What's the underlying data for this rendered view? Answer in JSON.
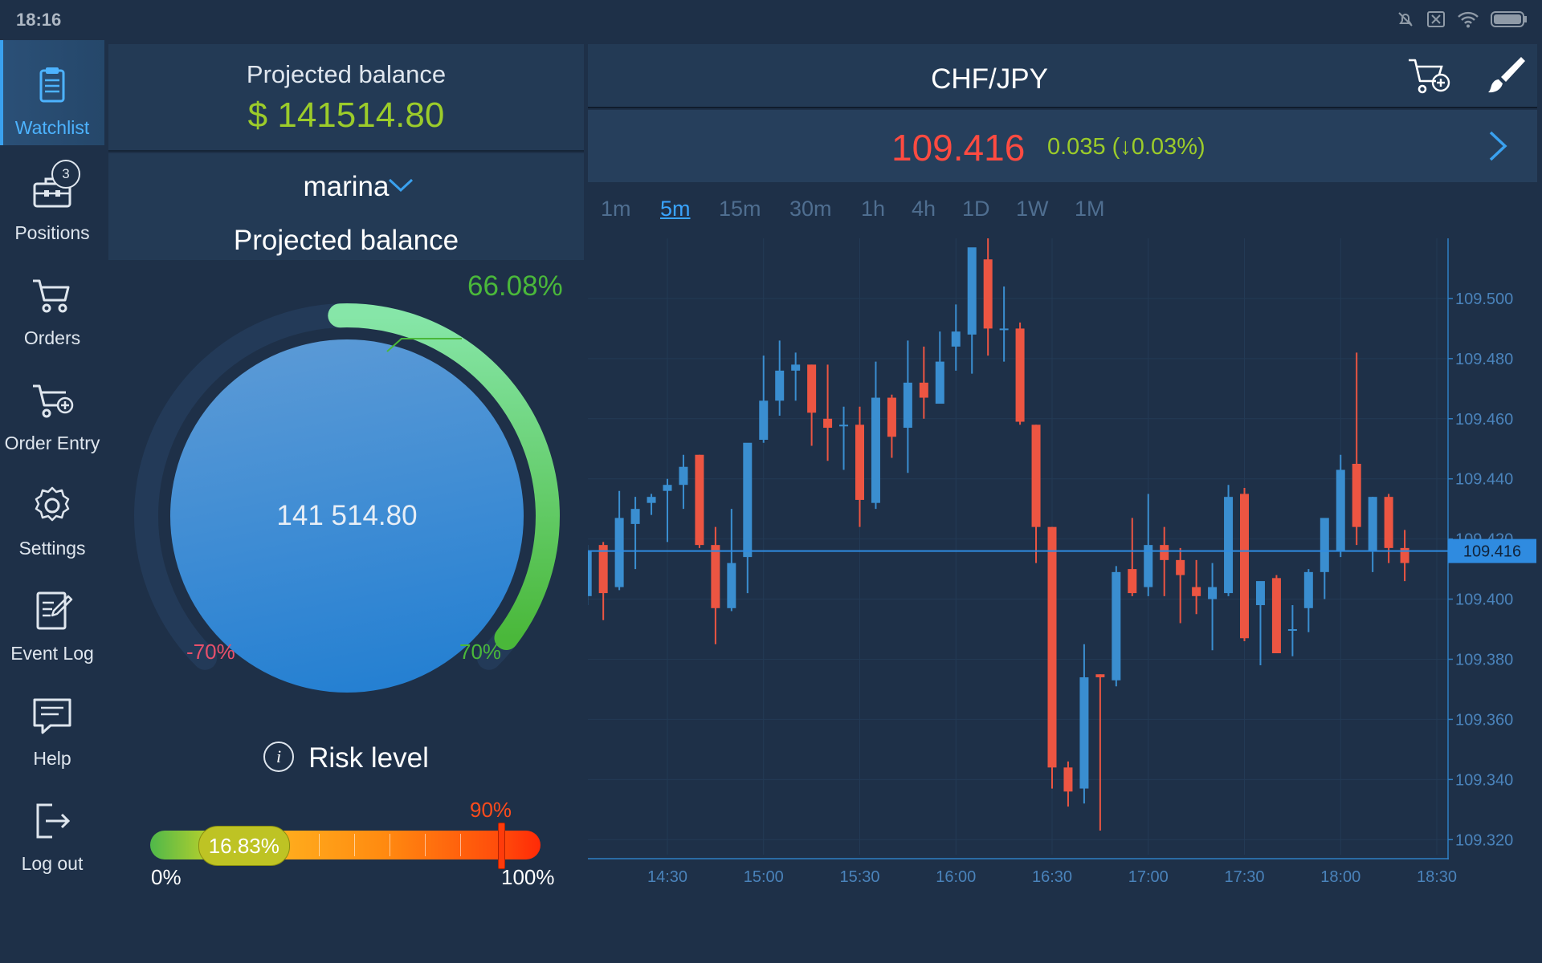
{
  "status_bar": {
    "time": "18:16",
    "icons": [
      "mute-icon",
      "notification-off-icon",
      "wifi-icon",
      "battery-icon"
    ]
  },
  "nav": {
    "items": [
      {
        "label": "Watchlist",
        "icon": "clipboard-icon",
        "active": true
      },
      {
        "label": "Positions",
        "icon": "briefcase-icon",
        "badge": "3"
      },
      {
        "label": "Orders",
        "icon": "cart-icon"
      },
      {
        "label": "Order Entry",
        "icon": "cart-add-icon"
      },
      {
        "label": "Settings",
        "icon": "gear-icon"
      },
      {
        "label": "Event Log",
        "icon": "event-log-icon"
      },
      {
        "label": "Help",
        "icon": "help-chat-icon"
      },
      {
        "label": "Log out",
        "icon": "logout-icon"
      }
    ]
  },
  "account": {
    "header_label": "Projected balance",
    "header_value": "$ 141514.80",
    "account_name": "marina",
    "gauge_title": "Projected balance",
    "gauge_value": "141 514.80",
    "gauge_percent_label": "66.08%",
    "gauge_percent": 66.08,
    "gauge_min_label": "-70%",
    "gauge_max_label": "70%",
    "risk_title": "Risk level",
    "risk_value_label": "16.83%",
    "risk_value": 16.83,
    "risk_threshold_label": "90%",
    "risk_threshold": 90,
    "risk_min_label": "0%",
    "risk_max_label": "100%"
  },
  "chart_panel": {
    "symbol": "CHF/JPY",
    "price": "109.416",
    "change": "0.035 (↓0.03%)",
    "timeframes": [
      "1m",
      "5m",
      "15m",
      "30m",
      "1h",
      "4h",
      "1D",
      "1W",
      "1M"
    ],
    "selected_timeframe": "5m"
  },
  "colors": {
    "up": "#3a8ed0",
    "down": "#ec5542",
    "accent": "#3aa1ef",
    "positive": "#9ccc2a",
    "negative": "#ff4b41"
  },
  "chart_data": {
    "type": "candlestick",
    "title": "",
    "ylim": [
      109.315,
      109.52
    ],
    "y_ticks": [
      109.5,
      109.48,
      109.46,
      109.44,
      109.42,
      109.4,
      109.38,
      109.36,
      109.34,
      109.32
    ],
    "y_tick_labels": [
      "109.500",
      "109.480",
      "109.460",
      "109.440",
      "109.420",
      "109.400",
      "109.380",
      "109.360",
      "109.340",
      "109.320"
    ],
    "x_tick_labels": [
      "14:30",
      "15:00",
      "15:30",
      "16:00",
      "16:30",
      "17:00",
      "17:30",
      "18:00",
      "18:30"
    ],
    "current_price": 109.416,
    "current_price_label": "109.416",
    "candles": [
      {
        "t": "14:05",
        "o": 109.401,
        "h": 109.418,
        "l": 109.398,
        "c": 109.416
      },
      {
        "t": "14:10",
        "o": 109.418,
        "h": 109.419,
        "l": 109.393,
        "c": 109.402
      },
      {
        "t": "14:15",
        "o": 109.404,
        "h": 109.436,
        "l": 109.403,
        "c": 109.427
      },
      {
        "t": "14:20",
        "o": 109.425,
        "h": 109.434,
        "l": 109.41,
        "c": 109.43
      },
      {
        "t": "14:25",
        "o": 109.432,
        "h": 109.435,
        "l": 109.428,
        "c": 109.434
      },
      {
        "t": "14:30",
        "o": 109.436,
        "h": 109.44,
        "l": 109.419,
        "c": 109.438
      },
      {
        "t": "14:35",
        "o": 109.438,
        "h": 109.448,
        "l": 109.43,
        "c": 109.444
      },
      {
        "t": "14:40",
        "o": 109.448,
        "h": 109.448,
        "l": 109.417,
        "c": 109.418
      },
      {
        "t": "14:45",
        "o": 109.418,
        "h": 109.424,
        "l": 109.385,
        "c": 109.397
      },
      {
        "t": "14:50",
        "o": 109.397,
        "h": 109.43,
        "l": 109.396,
        "c": 109.412
      },
      {
        "t": "14:55",
        "o": 109.414,
        "h": 109.45,
        "l": 109.402,
        "c": 109.452
      },
      {
        "t": "15:00",
        "o": 109.453,
        "h": 109.481,
        "l": 109.452,
        "c": 109.466
      },
      {
        "t": "15:05",
        "o": 109.466,
        "h": 109.486,
        "l": 109.461,
        "c": 109.476
      },
      {
        "t": "15:10",
        "o": 109.476,
        "h": 109.482,
        "l": 109.466,
        "c": 109.478
      },
      {
        "t": "15:15",
        "o": 109.478,
        "h": 109.478,
        "l": 109.451,
        "c": 109.462
      },
      {
        "t": "15:20",
        "o": 109.46,
        "h": 109.478,
        "l": 109.446,
        "c": 109.457
      },
      {
        "t": "15:25",
        "o": 109.458,
        "h": 109.464,
        "l": 109.443,
        "c": 109.458
      },
      {
        "t": "15:30",
        "o": 109.458,
        "h": 109.464,
        "l": 109.424,
        "c": 109.433
      },
      {
        "t": "15:35",
        "o": 109.432,
        "h": 109.479,
        "l": 109.43,
        "c": 109.467
      },
      {
        "t": "15:40",
        "o": 109.467,
        "h": 109.468,
        "l": 109.447,
        "c": 109.454
      },
      {
        "t": "15:45",
        "o": 109.457,
        "h": 109.486,
        "l": 109.442,
        "c": 109.472
      },
      {
        "t": "15:50",
        "o": 109.472,
        "h": 109.484,
        "l": 109.46,
        "c": 109.467
      },
      {
        "t": "15:55",
        "o": 109.465,
        "h": 109.489,
        "l": 109.465,
        "c": 109.479
      },
      {
        "t": "16:00",
        "o": 109.484,
        "h": 109.498,
        "l": 109.476,
        "c": 109.489
      },
      {
        "t": "16:05",
        "o": 109.488,
        "h": 109.514,
        "l": 109.475,
        "c": 109.517
      },
      {
        "t": "16:10",
        "o": 109.513,
        "h": 109.52,
        "l": 109.481,
        "c": 109.49
      },
      {
        "t": "16:15",
        "o": 109.49,
        "h": 109.504,
        "l": 109.479,
        "c": 109.49
      },
      {
        "t": "16:20",
        "o": 109.49,
        "h": 109.492,
        "l": 109.458,
        "c": 109.459
      },
      {
        "t": "16:25",
        "o": 109.458,
        "h": 109.458,
        "l": 109.412,
        "c": 109.424
      },
      {
        "t": "16:30",
        "o": 109.424,
        "h": 109.424,
        "l": 109.337,
        "c": 109.344
      },
      {
        "t": "16:35",
        "o": 109.344,
        "h": 109.346,
        "l": 109.331,
        "c": 109.336
      },
      {
        "t": "16:40",
        "o": 109.337,
        "h": 109.385,
        "l": 109.332,
        "c": 109.374
      },
      {
        "t": "16:45",
        "o": 109.375,
        "h": 109.375,
        "l": 109.323,
        "c": 109.374
      },
      {
        "t": "16:50",
        "o": 109.373,
        "h": 109.411,
        "l": 109.371,
        "c": 109.409
      },
      {
        "t": "16:55",
        "o": 109.41,
        "h": 109.427,
        "l": 109.401,
        "c": 109.402
      },
      {
        "t": "17:00",
        "o": 109.404,
        "h": 109.435,
        "l": 109.401,
        "c": 109.418
      },
      {
        "t": "17:05",
        "o": 109.418,
        "h": 109.424,
        "l": 109.401,
        "c": 109.413
      },
      {
        "t": "17:10",
        "o": 109.413,
        "h": 109.417,
        "l": 109.392,
        "c": 109.408
      },
      {
        "t": "17:15",
        "o": 109.404,
        "h": 109.413,
        "l": 109.395,
        "c": 109.401
      },
      {
        "t": "17:20",
        "o": 109.4,
        "h": 109.412,
        "l": 109.383,
        "c": 109.404
      },
      {
        "t": "17:25",
        "o": 109.402,
        "h": 109.438,
        "l": 109.401,
        "c": 109.434
      },
      {
        "t": "17:30",
        "o": 109.435,
        "h": 109.437,
        "l": 109.386,
        "c": 109.387
      },
      {
        "t": "17:35",
        "o": 109.398,
        "h": 109.405,
        "l": 109.378,
        "c": 109.406
      },
      {
        "t": "17:40",
        "o": 109.407,
        "h": 109.408,
        "l": 109.383,
        "c": 109.382
      },
      {
        "t": "17:45",
        "o": 109.39,
        "h": 109.398,
        "l": 109.381,
        "c": 109.39
      },
      {
        "t": "17:50",
        "o": 109.397,
        "h": 109.41,
        "l": 109.389,
        "c": 109.409
      },
      {
        "t": "17:55",
        "o": 109.409,
        "h": 109.423,
        "l": 109.4,
        "c": 109.427
      },
      {
        "t": "18:00",
        "o": 109.416,
        "h": 109.448,
        "l": 109.414,
        "c": 109.443
      },
      {
        "t": "18:05",
        "o": 109.445,
        "h": 109.482,
        "l": 109.418,
        "c": 109.424
      },
      {
        "t": "18:10",
        "o": 109.416,
        "h": 109.434,
        "l": 109.409,
        "c": 109.434
      },
      {
        "t": "18:15",
        "o": 109.434,
        "h": 109.435,
        "l": 109.412,
        "c": 109.417
      },
      {
        "t": "18:20",
        "o": 109.417,
        "h": 109.423,
        "l": 109.406,
        "c": 109.412
      }
    ]
  }
}
